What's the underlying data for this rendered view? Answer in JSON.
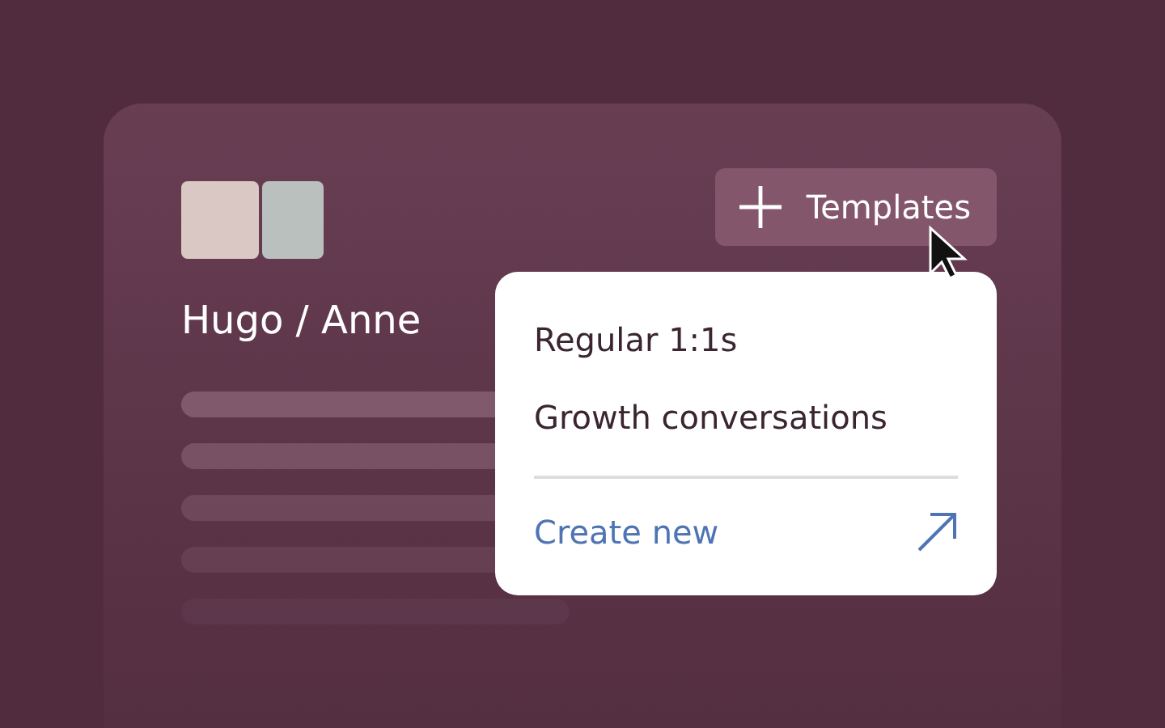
{
  "card": {
    "title": "Hugo / Anne",
    "templates_button": {
      "label": "Templates",
      "expanded": true
    },
    "menu": {
      "items": [
        {
          "label": "Regular 1:1s",
          "kind": "option"
        },
        {
          "label": "Growth conversations",
          "kind": "option"
        },
        {
          "label": "Create new",
          "kind": "link"
        }
      ]
    }
  }
}
